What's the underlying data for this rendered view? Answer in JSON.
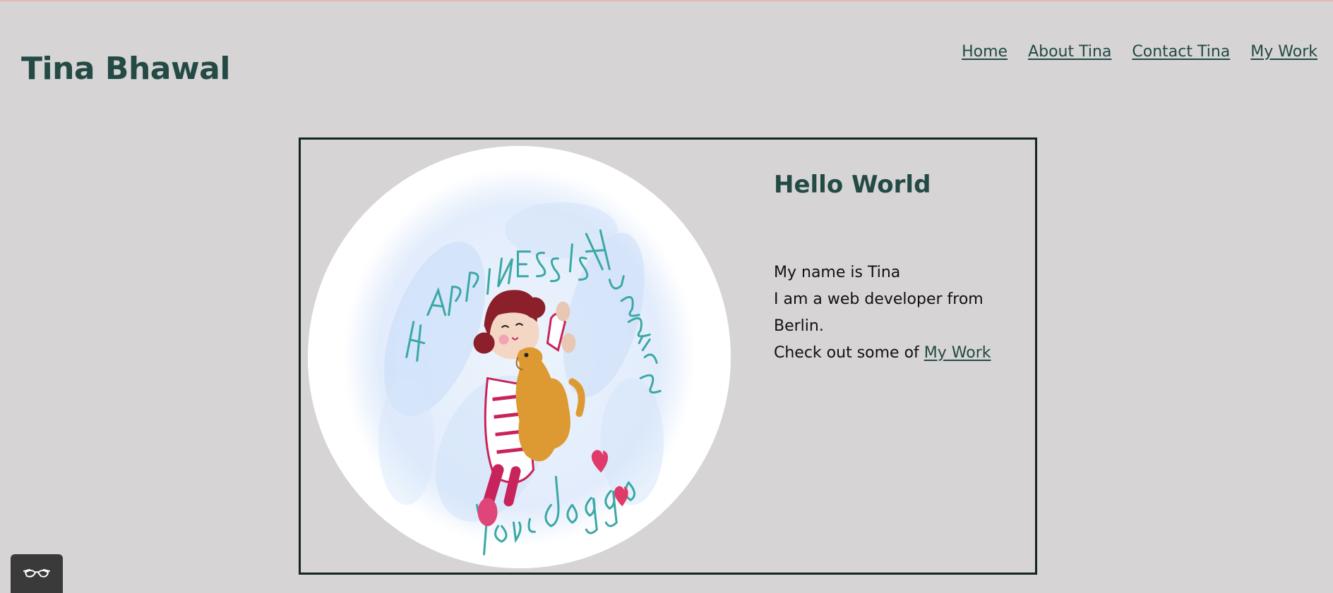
{
  "site": {
    "title": "Tina Bhawal"
  },
  "nav": {
    "items": [
      {
        "label": "Home"
      },
      {
        "label": "About Tina"
      },
      {
        "label": "Contact Tina"
      },
      {
        "label": "My Work"
      }
    ]
  },
  "card": {
    "heading": "Hello World",
    "line1": "My name is Tina",
    "line2": "I am a web developer from Berlin.",
    "line3_prefix": "Check out some of",
    "line3_link": "My Work",
    "image": {
      "lettering_top": "HAPPINESS IS Hugging",
      "lettering_bottom": "your doggo"
    }
  },
  "colors": {
    "background": "#d6d4d5",
    "accent": "#234a44",
    "card_border": "#122622"
  },
  "icons": {
    "accessibility": "glasses-icon"
  }
}
